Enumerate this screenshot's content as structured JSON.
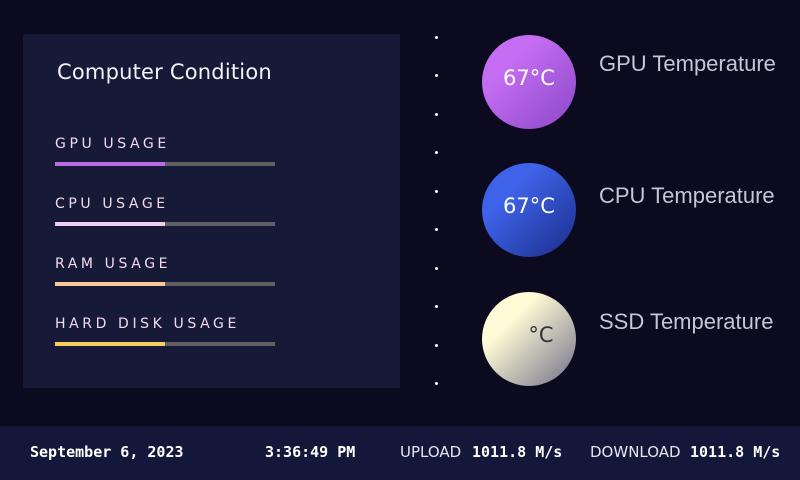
{
  "panel": {
    "title": "Computer Condition",
    "metrics": [
      {
        "label": "GPU USAGE",
        "fill": 0.5,
        "color": "#b96be6"
      },
      {
        "label": "CPU USAGE",
        "fill": 0.5,
        "color": "#f2cdf0"
      },
      {
        "label": "RAM USAGE",
        "fill": 0.5,
        "color": "#f9c799"
      },
      {
        "label": "HARD DISK USAGE",
        "fill": 0.5,
        "color": "#f9d060"
      }
    ]
  },
  "temperatures": [
    {
      "value": "67°C",
      "label": "GPU Temperature",
      "gradient": [
        "#c46df2",
        "#8a48c6"
      ]
    },
    {
      "value": "67°C",
      "label": "CPU Temperature",
      "gradient": [
        "#3f63e8",
        "#1a2c8a"
      ]
    },
    {
      "value": "°C",
      "label": "SSD Temperature",
      "gradient": [
        "#fffbd6",
        "#6f6f86"
      ]
    }
  ],
  "footer": {
    "date": "September 6, 2023",
    "time": "3:36:49 PM",
    "upload_label": "UPLOAD",
    "upload_value": "1011.8 M/s",
    "download_label": "DOWNLOAD",
    "download_value": "1011.8 M/s"
  }
}
